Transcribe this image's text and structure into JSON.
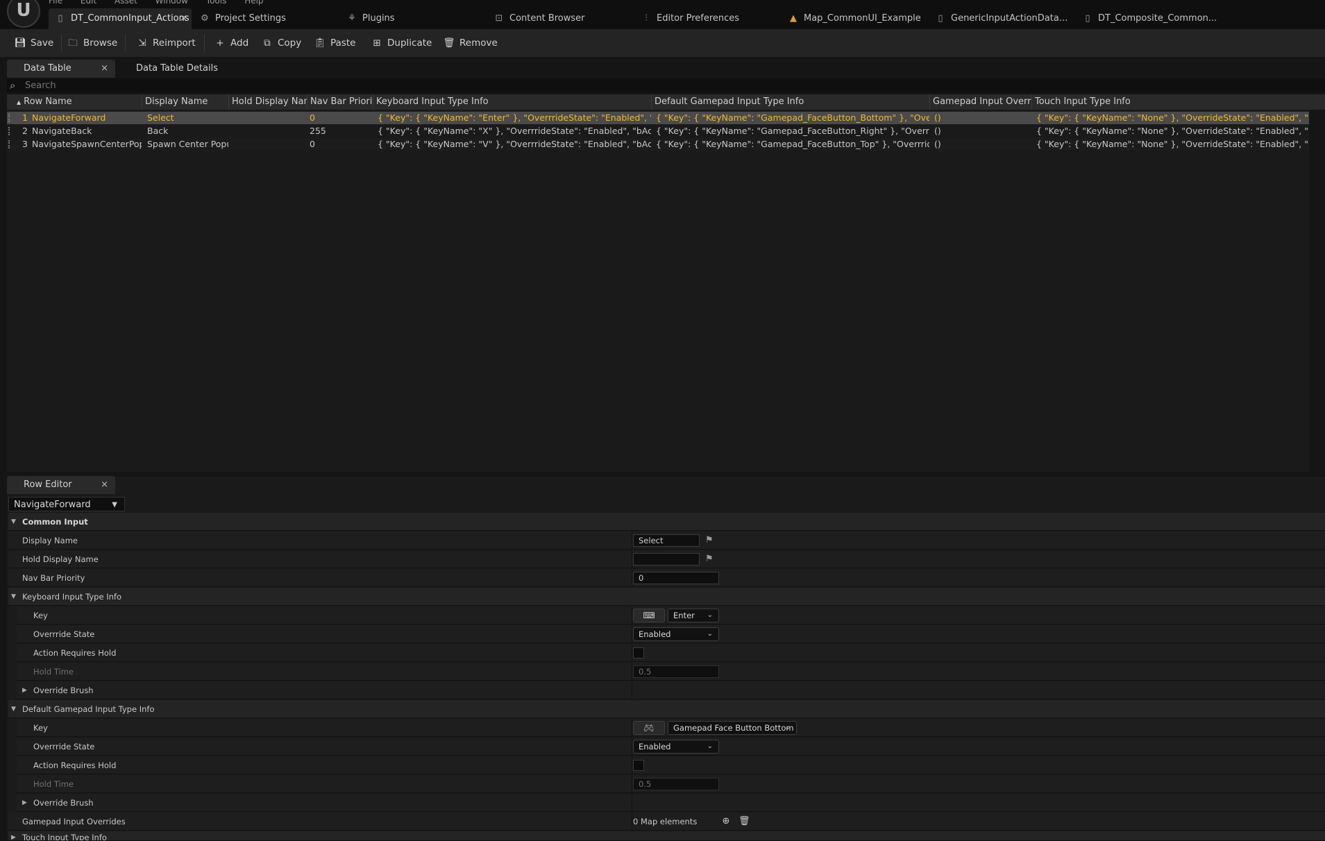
{
  "menu": [
    "File",
    "Edit",
    "Asset",
    "Window",
    "Tools",
    "Help"
  ],
  "tabs": [
    {
      "label": "DT_CommonInput_Actions",
      "icon": "data-table-icon"
    },
    {
      "label": "Project Settings",
      "icon": "gear-icon"
    },
    {
      "label": "Plugins",
      "icon": "plugin-icon"
    },
    {
      "label": "Content Browser",
      "icon": "folder-icon"
    },
    {
      "label": "Editor Preferences",
      "icon": "sliders-icon"
    },
    {
      "label": "Map_CommonUI_Example",
      "icon": "map-icon"
    },
    {
      "label": "GenericInputActionData...",
      "icon": "data-table-icon"
    },
    {
      "label": "DT_Composite_Common...",
      "icon": "data-table-icon"
    }
  ],
  "toolbar": {
    "save": "Save",
    "browse": "Browse",
    "reimport": "Reimport",
    "add": "Add",
    "copy": "Copy",
    "paste": "Paste",
    "duplicate": "Duplicate",
    "remove": "Remove"
  },
  "panel_tabs": {
    "data_table": "Data Table",
    "details": "Data Table Details",
    "row_editor": "Row Editor",
    "close": "×"
  },
  "search": {
    "placeholder": "Search"
  },
  "table": {
    "columns": [
      "Row Name",
      "Display Name",
      "Hold Display Name",
      "Nav Bar Priority",
      "Keyboard Input Type Info",
      "Default Gamepad Input Type Info",
      "Gamepad Input Overrides",
      "Touch Input Type Info"
    ],
    "rows": [
      {
        "index": "1",
        "row_name": "NavigateForward",
        "display_name": "Select",
        "hold_display_name": "",
        "nav_bar_priority": "0",
        "keyboard": "{ \"Key\": { \"KeyName\": \"Enter\" }, \"OverrrideState\": \"Enabled\", \"bActionRequiresHold\": false",
        "gamepad": "{ \"Key\": { \"KeyName\": \"Gamepad_FaceButton_Bottom\" }, \"OverrrideState\": \"Enabled\"",
        "overrides": "()",
        "touch": "{ \"Key\": { \"KeyName\": \"None\" }, \"OverrideState\": \"Enabled\", \"bActionRequiresHold\": false"
      },
      {
        "index": "2",
        "row_name": "NavigateBack",
        "display_name": "Back",
        "hold_display_name": "",
        "nav_bar_priority": "255",
        "keyboard": "{ \"Key\": { \"KeyName\": \"X\" }, \"OverrrideState\": \"Enabled\", \"bActionRequiresHold\": false",
        "gamepad": "{ \"Key\": { \"KeyName\": \"Gamepad_FaceButton_Right\" }, \"OverrrideState\": \"Enabled\"",
        "overrides": "()",
        "touch": "{ \"Key\": { \"KeyName\": \"None\" }, \"OverrideState\": \"Enabled\", \"bActionRequiresHold\": false"
      },
      {
        "index": "3",
        "row_name": "NavigateSpawnCenterPopup",
        "display_name": "Spawn Center Popup",
        "hold_display_name": "",
        "nav_bar_priority": "0",
        "keyboard": "{ \"Key\": { \"KeyName\": \"V\" }, \"OverrrideState\": \"Enabled\", \"bActionRequiresHold\": false",
        "gamepad": "{ \"Key\": { \"KeyName\": \"Gamepad_FaceButton_Top\" }, \"OverrrideState\": \"Enabled\"",
        "overrides": "()",
        "touch": "{ \"Key\": { \"KeyName\": \"None\" }, \"OverrideState\": \"Enabled\", \"bActionRequiresHold\": false"
      }
    ]
  },
  "row_editor": {
    "selected_row": "NavigateForward",
    "common_input": "Common Input",
    "display_name_label": "Display Name",
    "display_name_value": "Select",
    "hold_display_name_label": "Hold Display Name",
    "hold_display_name_value": "",
    "nav_bar_priority_label": "Nav Bar Priority",
    "nav_bar_priority_value": "0",
    "keyboard_section": "Keyboard Input Type Info",
    "key_label": "Key",
    "keyboard_key": "Enter",
    "override_state_label": "Overrride State",
    "override_state_value": "Enabled",
    "action_requires_hold_label": "Action Requires Hold",
    "hold_time_label": "Hold Time",
    "hold_time_value": "0.5",
    "override_brush_label": "Override Brush",
    "gamepad_section": "Default Gamepad Input Type Info",
    "gamepad_key": "Gamepad Face Button Bottom",
    "gamepad_overrides_label": "Gamepad Input Overrides",
    "map_elements": "0 Map elements",
    "touch_section": "Touch Input Type Info"
  }
}
